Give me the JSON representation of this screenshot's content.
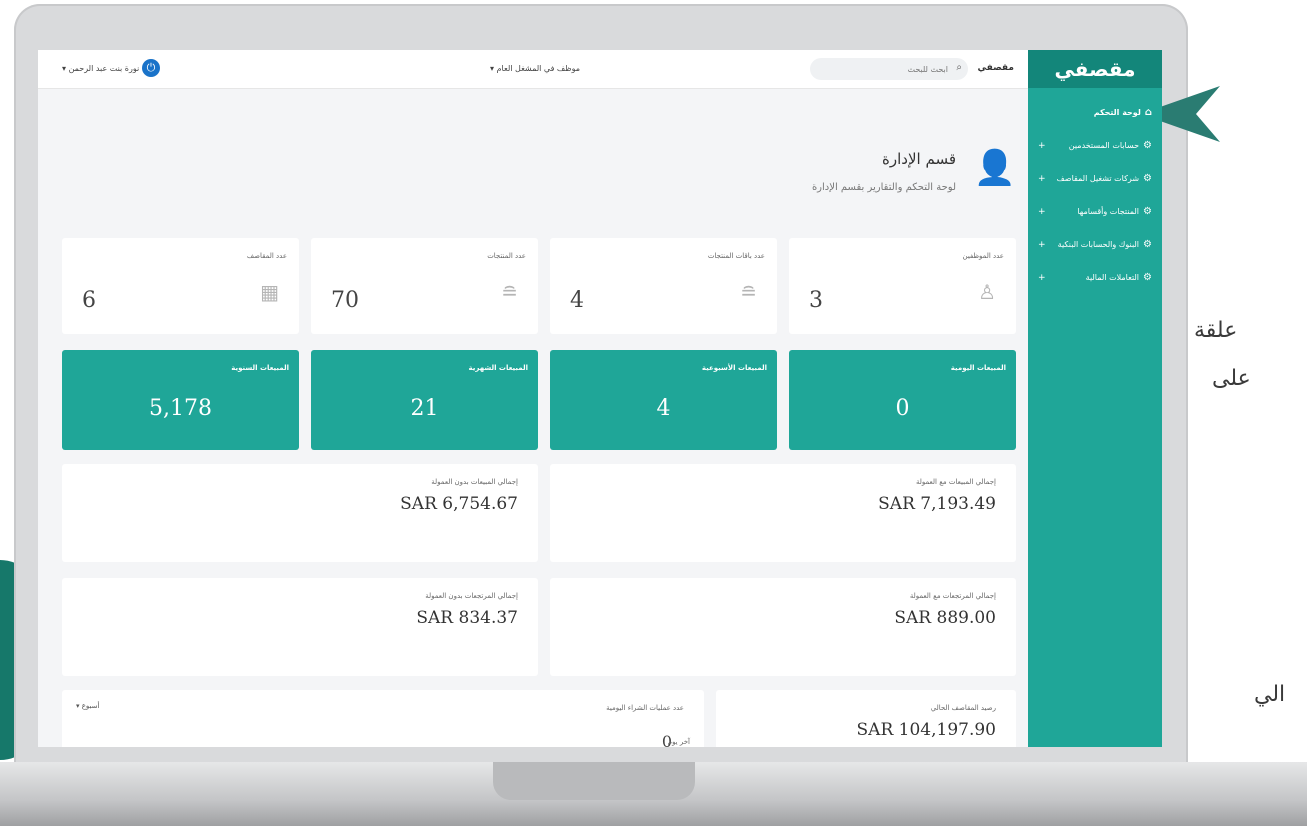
{
  "brand": {
    "logo": "مقصفي",
    "topbar_name": "مقصفي"
  },
  "topbar": {
    "search_placeholder": "ابحث للبحث",
    "role": "موظف في المشغل العام",
    "user": "نورة بنت عبد الرحمن"
  },
  "sidebar": {
    "items": [
      {
        "label": "لوحة التحكم",
        "expandable": false
      },
      {
        "label": "حسابات المستخدمين",
        "expandable": true
      },
      {
        "label": "شركات تشغيل المقاصف",
        "expandable": true
      },
      {
        "label": "المنتجات وأقسامها",
        "expandable": true
      },
      {
        "label": "البنوك والحسابات البنكية",
        "expandable": true
      },
      {
        "label": "التعاملات المالية",
        "expandable": true
      }
    ]
  },
  "section": {
    "title": "قسم الإدارة",
    "subtitle": "لوحة التحكم والتقارير بقسم الإدارة"
  },
  "stats": [
    {
      "label": "عدد الموظفين",
      "value": "3"
    },
    {
      "label": "عدد باقات المنتجات",
      "value": "4"
    },
    {
      "label": "عدد المنتجات",
      "value": "70"
    },
    {
      "label": "عدد المقاصف",
      "value": "6"
    }
  ],
  "sales": [
    {
      "label": "المبيعات اليومية",
      "value": "0"
    },
    {
      "label": "المبيعات الأسبوعية",
      "value": "4"
    },
    {
      "label": "المبيعات الشهرية",
      "value": "21"
    },
    {
      "label": "المبيعات السنوية",
      "value": "5,178"
    }
  ],
  "totals": [
    {
      "label": "إجمالي المبيعات مع العمولة",
      "value": "SAR 7,193.49"
    },
    {
      "label": "إجمالي المبيعات بدون العمولة",
      "value": "SAR 6,754.67"
    },
    {
      "label": "إجمالي المرتجعات مع العمولة",
      "value": "SAR 889.00"
    },
    {
      "label": "إجمالي المرتجعات بدون العمولة",
      "value": "SAR 834.37"
    }
  ],
  "balance": {
    "label": "رصيد المقاصف الحالي",
    "value": "SAR 104,197.90"
  },
  "daily_purchases": {
    "label": "عدد عمليات الشراء اليومية",
    "count": "0",
    "unit": "آخر يوم",
    "dropdown": "أسبوع"
  },
  "overlay": {
    "line1": "علقة",
    "line2": "على",
    "line3": "الي"
  },
  "colors": {
    "teal": "#1fa698",
    "teal_dark": "#13867a",
    "frame": "#d9dadc"
  }
}
